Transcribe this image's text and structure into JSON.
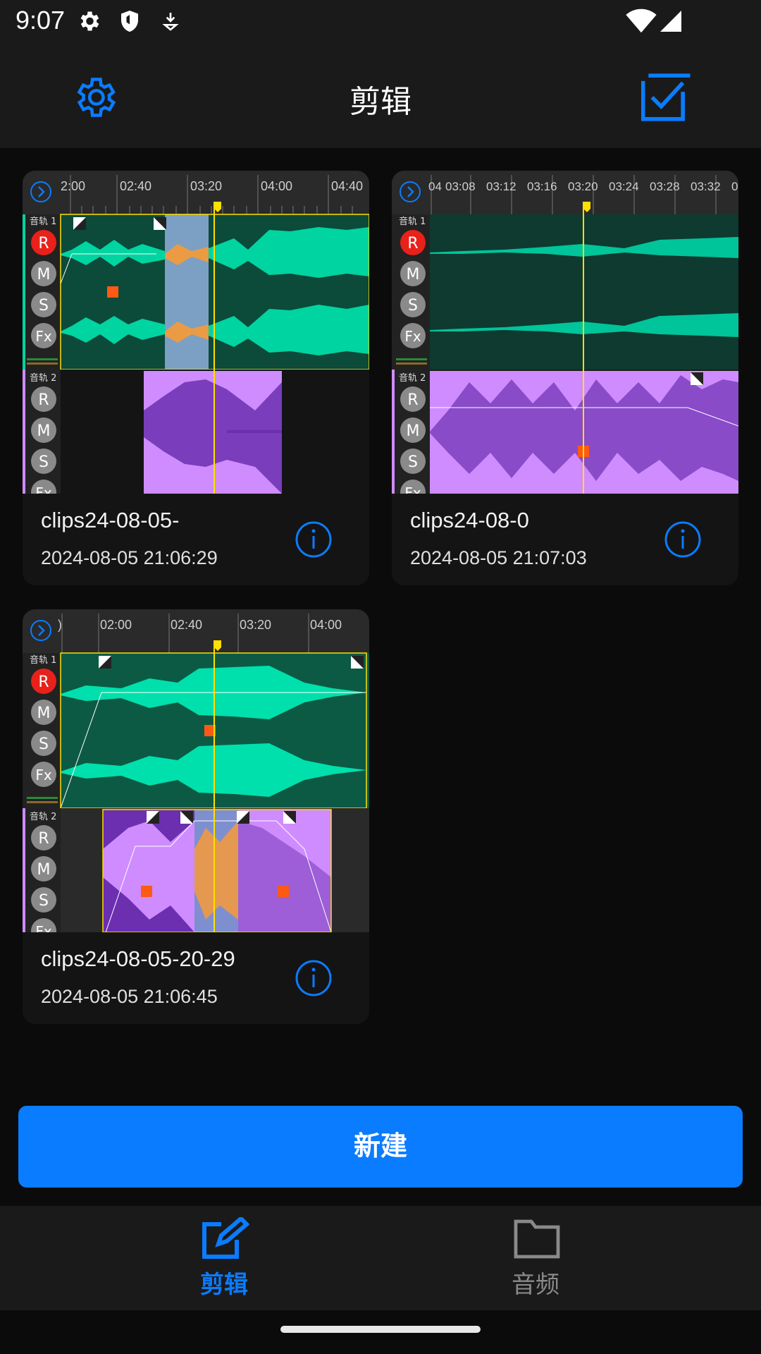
{
  "status_bar": {
    "time": "9:07"
  },
  "header": {
    "title": "剪辑"
  },
  "projects": [
    {
      "name": "clips24-08-05-",
      "date": "2024-08-05 21:06:29",
      "ruler_ticks": [
        "2:00",
        "02:40",
        "03:20",
        "04:00",
        "04:40"
      ],
      "tracks": [
        {
          "label": "音轨 1",
          "buttons": [
            "R",
            "M",
            "S",
            "Fx"
          ]
        },
        {
          "label": "音轨 2",
          "buttons": [
            "R",
            "M",
            "S",
            "Fx"
          ]
        }
      ]
    },
    {
      "name": "clips24-08-0",
      "date": "2024-08-05 21:07:03",
      "ruler_ticks": [
        "04",
        "03:08",
        "03:12",
        "03:16",
        "03:20",
        "03:24",
        "03:28",
        "03:32",
        "0"
      ],
      "tracks": [
        {
          "label": "音轨 1",
          "buttons": [
            "R",
            "M",
            "S",
            "Fx"
          ]
        },
        {
          "label": "音轨 2",
          "buttons": [
            "R",
            "M",
            "S",
            "Fx"
          ]
        }
      ]
    },
    {
      "name": "clips24-08-05-20-29",
      "date": "2024-08-05 21:06:45",
      "ruler_ticks": [
        ")",
        "02:00",
        "02:40",
        "03:20",
        "04:00"
      ],
      "tracks": [
        {
          "label": "音轨 1",
          "buttons": [
            "R",
            "M",
            "S",
            "Fx"
          ]
        },
        {
          "label": "音轨 2",
          "buttons": [
            "R",
            "M",
            "S",
            "Fx"
          ]
        }
      ]
    }
  ],
  "new_button": {
    "label": "新建"
  },
  "bottom_nav": {
    "items": [
      {
        "label": "剪辑",
        "active": true
      },
      {
        "label": "音频",
        "active": false
      }
    ]
  },
  "colors": {
    "accent": "#0a7cff",
    "track1_wave": "#00d4a0",
    "track1_bg": "#0c4a3a",
    "track2_wave": "#cf8cff",
    "track2_bg": "#6b2fb0",
    "playhead": "#ffe000",
    "record": "#e8211b",
    "selection": "#ff9a2e",
    "inactive": "#8a8a8a"
  }
}
